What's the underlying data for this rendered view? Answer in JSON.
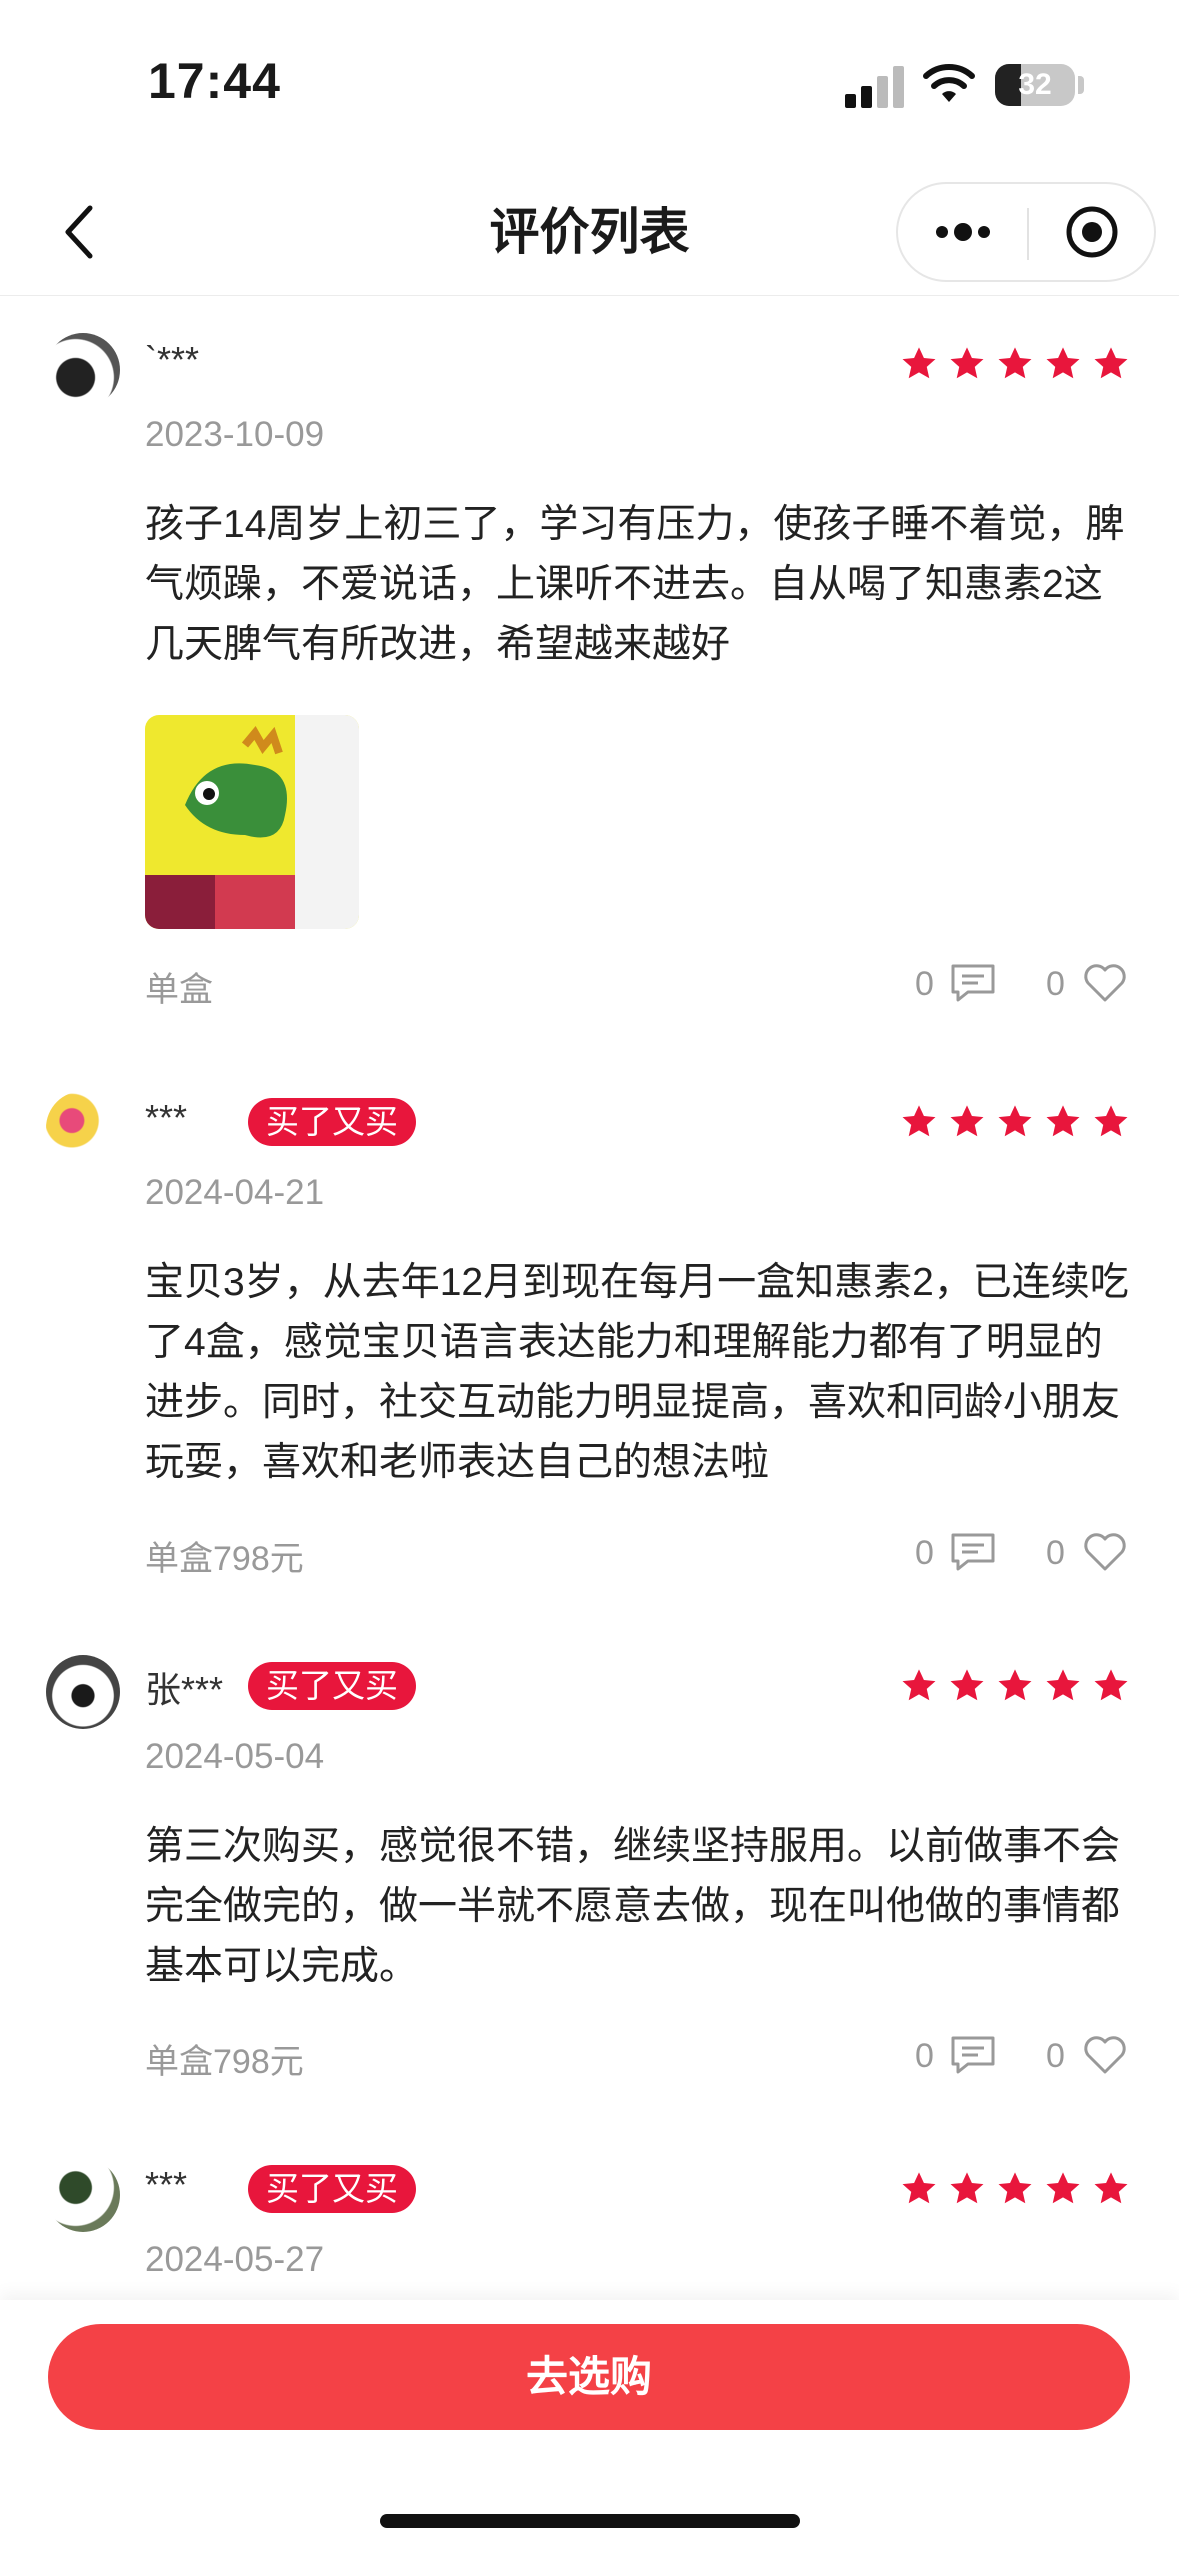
{
  "status_bar": {
    "time": "17:44",
    "battery": "32",
    "battery_level": 0.32
  },
  "nav": {
    "title": "评价列表"
  },
  "reviews": [
    {
      "username": "`***",
      "date": "2023-10-09",
      "rating": 5,
      "content": "孩子14周岁上初三了，学习有压力，使孩子睡不着觉，脾气烦躁，不爱说话，上课听不进去。自从喝了知惠素2这几天脾气有所改进，希望越来越好",
      "spec": "单盒",
      "comments": "0",
      "likes": "0"
    },
    {
      "username": "***",
      "badge": "买了又买",
      "date": "2024-04-21",
      "rating": 5,
      "content": "宝贝3岁，从去年12月到现在每月一盒知惠素2，已连续吃了4盒，感觉宝贝语言表达能力和理解能力都有了明显的进步。同时，社交互动能力明显提高，喜欢和同龄小朋友玩耍，喜欢和老师表达自己的想法啦",
      "spec": "单盒798元",
      "comments": "0",
      "likes": "0"
    },
    {
      "username": "张***",
      "badge": "买了又买",
      "date": "2024-05-04",
      "rating": 5,
      "content": "第三次购买，感觉很不错，继续坚持服用。以前做事不会完全做完的，做一半就不愿意去做，现在叫他做的事情都基本可以完成。",
      "spec": "单盒798元",
      "comments": "0",
      "likes": "0"
    },
    {
      "username": "***",
      "badge": "买了又买",
      "date": "2024-05-27",
      "rating": 5
    }
  ],
  "buy_button": {
    "label": "去选购"
  },
  "colors": {
    "accent": "#f44146",
    "star": "#e8163c",
    "badge": "#e8163c"
  }
}
